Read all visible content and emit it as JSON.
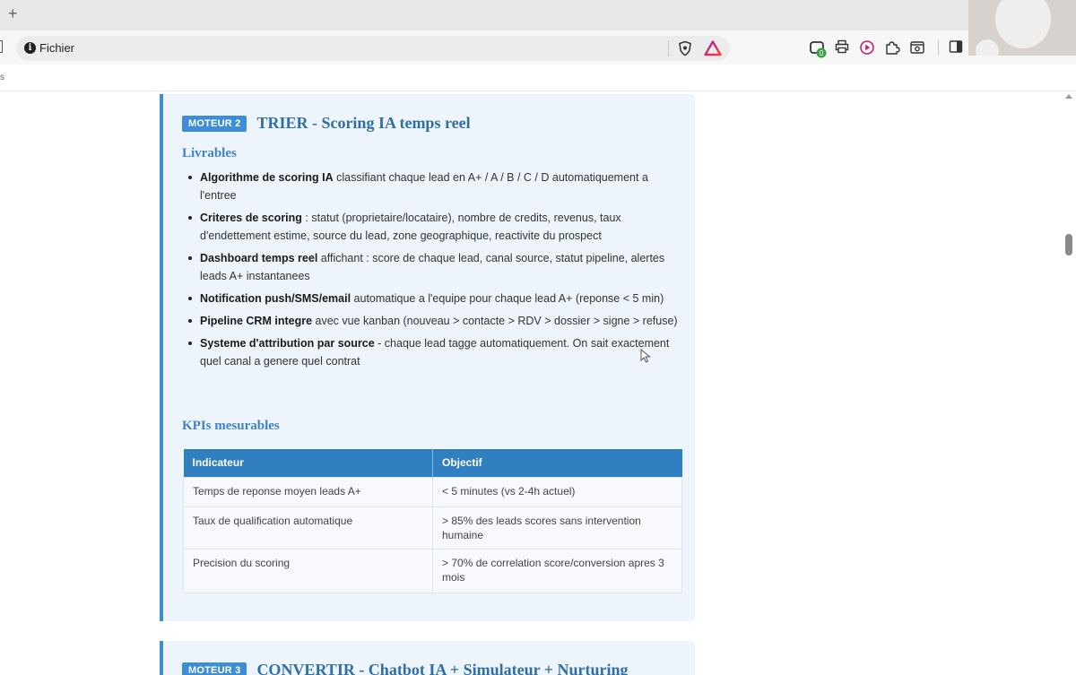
{
  "browser": {
    "address_label": "Fichier",
    "new_tab_label": "+",
    "bookmark_stub": "s",
    "extensions": [
      {
        "icon": "extension-counter-icon",
        "badge": "0"
      },
      {
        "icon": "printer-icon"
      },
      {
        "icon": "record-icon"
      },
      {
        "icon": "puzzle-icon"
      },
      {
        "icon": "screenshot-icon"
      },
      {
        "icon": "sidebar-icon"
      }
    ]
  },
  "card2": {
    "badge": "MOTEUR 2",
    "title": "TRIER - Scoring IA temps reel",
    "livrables_heading": "Livrables",
    "bullets": [
      {
        "bold": "Algorithme de scoring IA",
        "text": " classifiant chaque lead en A+ / A / B / C / D automatiquement a l'entree"
      },
      {
        "bold": "Criteres de scoring",
        "text": " : statut (proprietaire/locataire), nombre de credits, revenus, taux d'endettement estime, source du lead, zone geographique, reactivite du prospect"
      },
      {
        "bold": "Dashboard temps reel",
        "text": " affichant : score de chaque lead, canal source, statut pipeline, alertes leads A+ instantanees"
      },
      {
        "bold": "Notification push/SMS/email",
        "text": " automatique a l'equipe pour chaque lead A+ (reponse < 5 min)"
      },
      {
        "bold": "Pipeline CRM integre",
        "text": " avec vue kanban (nouveau > contacte > RDV > dossier > signe > refuse)"
      },
      {
        "bold": "Systeme d'attribution par source",
        "text": " - chaque lead tagge automatiquement. On sait exactement quel canal a genere quel contrat"
      }
    ],
    "kpi_heading": "KPIs mesurables",
    "kpi_table": {
      "headers": [
        "Indicateur",
        "Objectif"
      ],
      "rows": [
        [
          "Temps de reponse moyen leads A+",
          "< 5 minutes (vs 2-4h actuel)"
        ],
        [
          "Taux de qualification automatique",
          "> 85% des leads scores sans intervention humaine"
        ],
        [
          "Precision du scoring",
          "> 70% de correlation score/conversion apres 3 mois"
        ]
      ]
    }
  },
  "card3": {
    "badge": "MOTEUR 3",
    "title": "CONVERTIR - Chatbot IA + Simulateur + Nurturing"
  },
  "colors": {
    "accent": "#3d8ed6",
    "card_background": "#eef4fb",
    "table_header": "#2f7fc1",
    "title": "#2f6fa3"
  }
}
